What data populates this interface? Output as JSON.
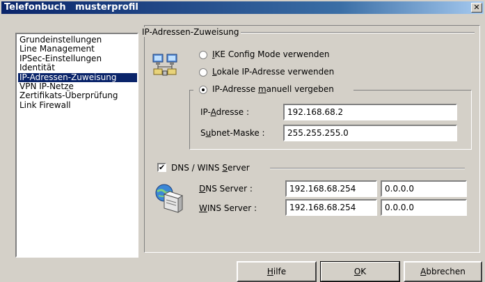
{
  "window": {
    "title": "Telefonbuch   musterprofil",
    "close_glyph": "✕"
  },
  "sidebar": {
    "items": [
      {
        "label": "Grundeinstellungen",
        "selected": false
      },
      {
        "label": "Line Management",
        "selected": false
      },
      {
        "label": "IPSec-Einstellungen",
        "selected": false
      },
      {
        "label": "Identität",
        "selected": false
      },
      {
        "label": "IP-Adressen-Zuweisung",
        "selected": true
      },
      {
        "label": "VPN IP-Netze",
        "selected": false
      },
      {
        "label": "Zertifikats-Überprüfung",
        "selected": false
      },
      {
        "label": "Link Firewall",
        "selected": false
      }
    ]
  },
  "ip_assignment": {
    "group_title": "IP-Adressen-Zuweisung",
    "icon": "network-computers-icon",
    "options": {
      "ike": {
        "prefix": "",
        "mnemonic": "I",
        "rest": "KE Config Mode verwenden",
        "selected": false
      },
      "local": {
        "prefix": "",
        "mnemonic": "L",
        "rest": "okale IP-Adresse verwenden",
        "selected": false
      },
      "manual": {
        "prefix": "IP-Adresse ",
        "mnemonic": "m",
        "rest": "anuell vergeben",
        "selected": true
      }
    },
    "ip_address": {
      "prefix": "IP-",
      "mnemonic": "A",
      "rest": "dresse :",
      "value": "192.168.68.2"
    },
    "subnet_mask": {
      "prefix": "S",
      "mnemonic": "u",
      "rest": "bnet-Maske :",
      "value": "255.255.255.0"
    }
  },
  "dns_wins": {
    "checkbox_checked": true,
    "checkbox_glyph": "✔",
    "label_prefix": "DNS / WINS ",
    "label_mnemonic": "S",
    "label_rest": "erver",
    "icon": "server-globe-icon",
    "dns": {
      "mnemonic": "D",
      "rest": "NS Server :",
      "primary": "192.168.68.254",
      "secondary": "0.0.0.0"
    },
    "wins": {
      "mnemonic": "W",
      "rest": "INS Server :",
      "primary": "192.168.68.254",
      "secondary": "0.0.0.0"
    }
  },
  "buttons": {
    "help": {
      "mnemonic": "H",
      "rest": "ilfe"
    },
    "ok": {
      "mnemonic": "O",
      "rest": "K"
    },
    "cancel": {
      "mnemonic": "A",
      "rest": "bbrechen"
    }
  }
}
